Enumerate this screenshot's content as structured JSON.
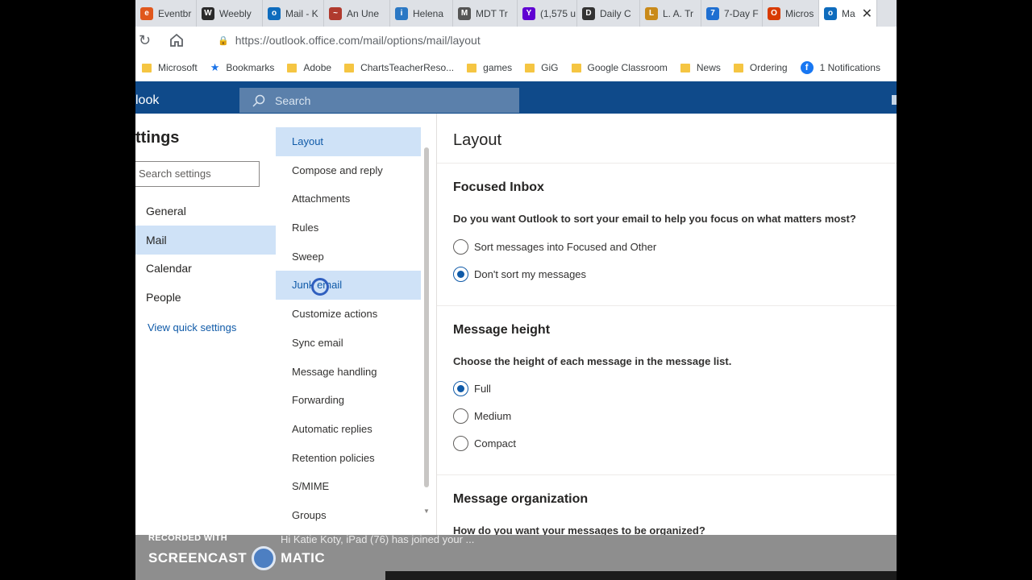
{
  "browser": {
    "tabs": [
      {
        "label": "Eventbr",
        "icon": "e",
        "color": "#e0571c"
      },
      {
        "label": "Weebly",
        "icon": "W",
        "color": "#2a2a2a"
      },
      {
        "label": "Mail - K",
        "icon": "o",
        "color": "#0f6cbd"
      },
      {
        "label": "An Une",
        "icon": "~",
        "color": "#b03a2e"
      },
      {
        "label": "Helena",
        "icon": "i",
        "color": "#2b78c4"
      },
      {
        "label": "MDT Tr",
        "icon": "M",
        "color": "#555555"
      },
      {
        "label": "(1,575 u",
        "icon": "Y",
        "color": "#6001d2"
      },
      {
        "label": "Daily C",
        "icon": "D",
        "color": "#333333"
      },
      {
        "label": "L. A. Tr",
        "icon": "L",
        "color": "#c98a1a"
      },
      {
        "label": "7-Day F",
        "icon": "7",
        "color": "#1f6fd1"
      },
      {
        "label": "Micros",
        "icon": "O",
        "color": "#d83b01"
      },
      {
        "label": "Ma",
        "icon": "o",
        "color": "#0f6cbd"
      }
    ],
    "url": "https://outlook.office.com/mail/options/mail/layout",
    "bookmarks": [
      {
        "label": "Microsoft",
        "type": "folder"
      },
      {
        "label": "Bookmarks",
        "type": "star"
      },
      {
        "label": "Adobe",
        "type": "folder"
      },
      {
        "label": "ChartsTeacherReso...",
        "type": "folder"
      },
      {
        "label": "games",
        "type": "folder"
      },
      {
        "label": "GiG",
        "type": "folder"
      },
      {
        "label": "Google Classroom",
        "type": "folder"
      },
      {
        "label": "News",
        "type": "folder"
      },
      {
        "label": "Ordering",
        "type": "folder"
      },
      {
        "label": "1 Notifications",
        "type": "facebook"
      }
    ]
  },
  "outlook": {
    "brand": "look",
    "search_placeholder": "Search"
  },
  "settings": {
    "title": "ttings",
    "search_placeholder": "Search settings",
    "categories": [
      "General",
      "Mail",
      "Calendar",
      "People"
    ],
    "selected_category": "Mail",
    "view_quick": "View quick settings",
    "subnav": [
      "Layout",
      "Compose and reply",
      "Attachments",
      "Rules",
      "Sweep",
      "Junk email",
      "Customize actions",
      "Sync email",
      "Message handling",
      "Forwarding",
      "Automatic replies",
      "Retention policies",
      "S/MIME",
      "Groups"
    ]
  },
  "panel": {
    "title": "Layout",
    "focused": {
      "heading": "Focused Inbox",
      "question": "Do you want Outlook to sort your email to help you focus on what matters most?",
      "options": [
        "Sort messages into Focused and Other",
        "Don't sort my messages"
      ],
      "selected": 1
    },
    "height": {
      "heading": "Message height",
      "question": "Choose the height of each message in the message list.",
      "options": [
        "Full",
        "Medium",
        "Compact"
      ],
      "selected": 0
    },
    "organization": {
      "heading": "Message organization",
      "question": "How do you want your messages to be organized?"
    }
  },
  "overlay": {
    "recorded": "RECORDED WITH",
    "brand_left": "SCREENCAST",
    "brand_right": "MATIC",
    "notice": "Hi Katie Koty, iPad (76) has joined your ..."
  }
}
